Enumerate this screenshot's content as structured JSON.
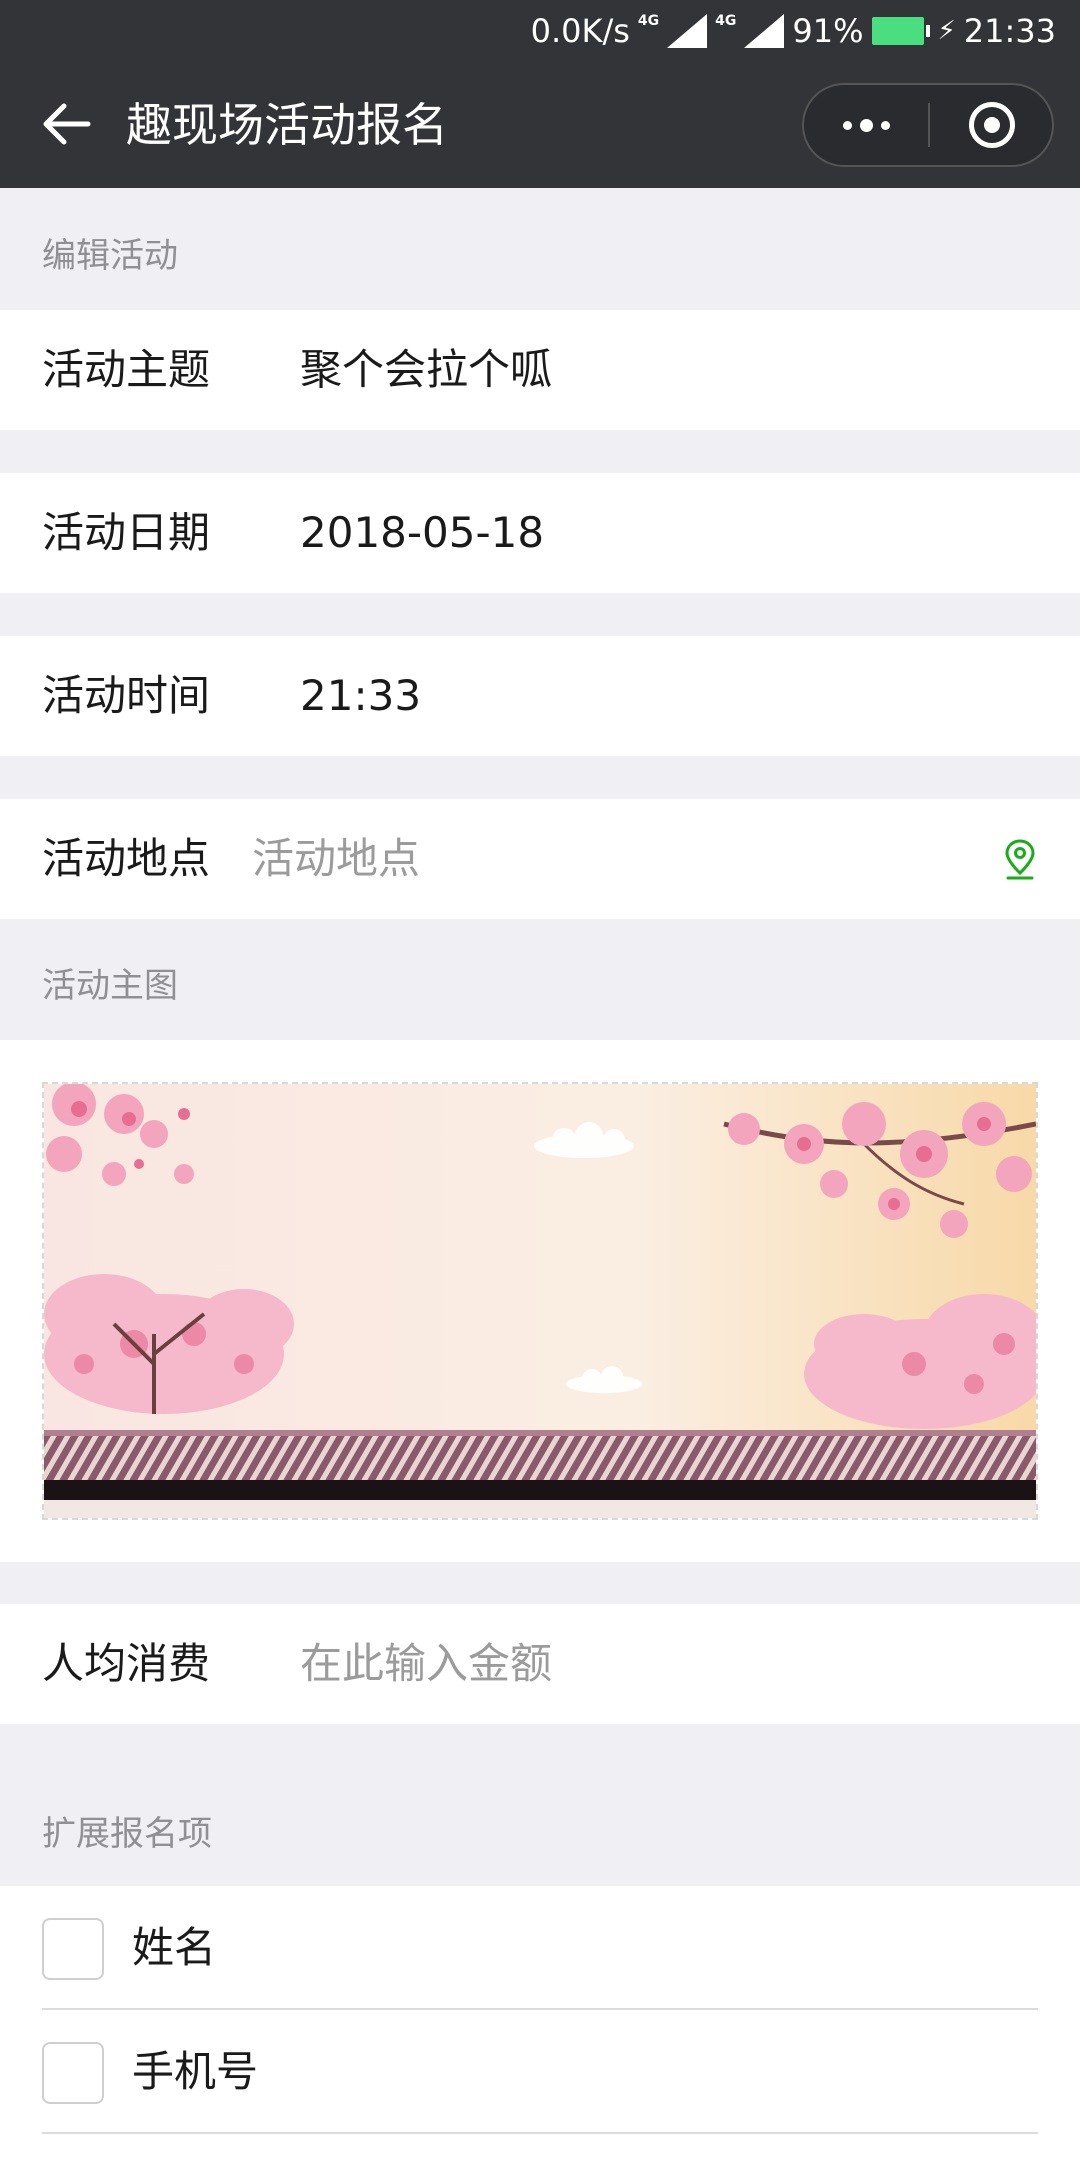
{
  "status_bar": {
    "net_speed": "0.0K/s",
    "net_type_1": "4G",
    "net_type_2": "4G",
    "battery": "91%",
    "time": "21:33",
    "battery_color": "#4ade80"
  },
  "nav": {
    "title": "趣现场活动报名",
    "back_icon": "back-arrow-icon",
    "more_icon": "more-dots-icon",
    "close_icon": "target-close-icon"
  },
  "edit_section": {
    "label": "编辑活动",
    "topic": {
      "label": "活动主题",
      "value": "聚个会拉个呱"
    },
    "date": {
      "label": "活动日期",
      "value": "2018-05-18"
    },
    "time": {
      "label": "活动时间",
      "value": "21:33"
    },
    "location": {
      "label": "活动地点",
      "placeholder": "活动地点",
      "icon": "location-pin-icon",
      "icon_color": "#1aad19"
    }
  },
  "image_section": {
    "label": "活动主图",
    "image": "cherry-blossom-banner"
  },
  "cost": {
    "label": "人均消费",
    "placeholder": "在此输入金额"
  },
  "extend_section": {
    "label": "扩展报名项",
    "items": [
      {
        "label": "姓名",
        "checked": false
      },
      {
        "label": "手机号",
        "checked": false
      }
    ]
  },
  "colors": {
    "header_bg": "#333438",
    "page_bg": "#efeff4",
    "accent_green": "#1aad19"
  }
}
